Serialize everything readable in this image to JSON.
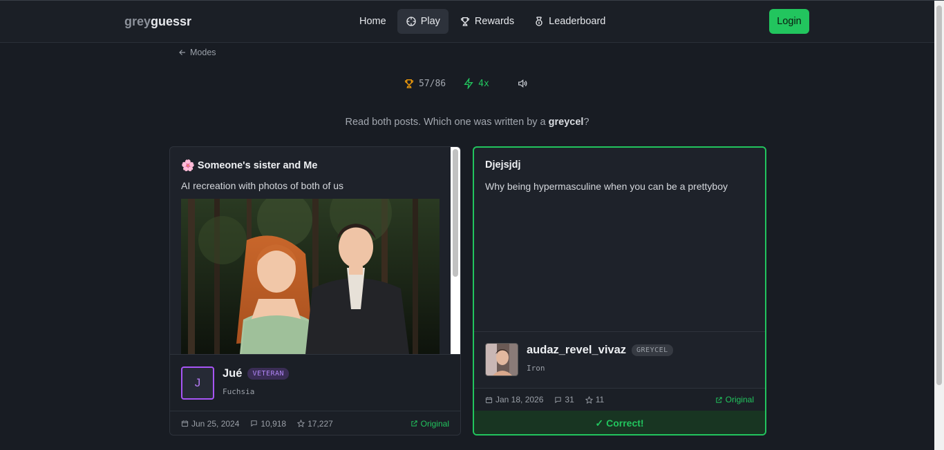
{
  "app": {
    "logo_grey": "grey",
    "logo_guessr": "guessr",
    "nav": [
      {
        "label": "Home",
        "icon": null
      },
      {
        "label": "Play",
        "icon": "crosshair-icon"
      },
      {
        "label": "Rewards",
        "icon": "trophy-icon"
      },
      {
        "label": "Leaderboard",
        "icon": "medal-icon"
      }
    ],
    "active_nav": "Play",
    "login_label": "Login",
    "accent": "#22c55e"
  },
  "back": {
    "label": "Modes"
  },
  "stats": {
    "score": "57/86",
    "streak": "4x"
  },
  "prompt": {
    "before": "Read both posts. Which one was written by a ",
    "emphasis": "greycel",
    "after": "?"
  },
  "left_post": {
    "title": "Someone's sister and Me",
    "title_emoji": "🌸",
    "body": "AI recreation with photos of both of us",
    "author": {
      "initial": "J",
      "name": "Jué",
      "badge": "VETERAN",
      "rank": "Fuchsia"
    },
    "meta": {
      "date": "Jun 25, 2024",
      "comments": "10,918",
      "stars": "17,227",
      "link": "Original"
    }
  },
  "right_post": {
    "title": "Djejsjdj",
    "body": "Why being hypermasculine when you can be a prettyboy",
    "author": {
      "name": "audaz_revel_vivaz",
      "badge": "GREYCEL",
      "rank": "Iron"
    },
    "meta": {
      "date": "Jan 18, 2026",
      "comments": "31",
      "stars": "11",
      "link": "Original"
    },
    "result": "Correct!",
    "result_mark": "✓"
  }
}
